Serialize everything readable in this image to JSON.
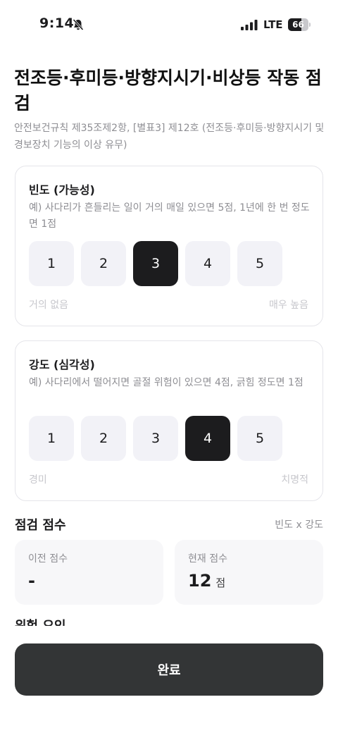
{
  "status_bar": {
    "time": "9:14",
    "network": "LTE",
    "battery": "66",
    "battery_level": 0.66
  },
  "page": {
    "title": "전조등·후미등·방향지시기·비상등 작동 점검",
    "subtitle": "안전보건규칙 제35조제2항, [별표3] 제12호 (전조등·후미등·방향지시기 및 경보장치 기능의 이상 유무)"
  },
  "frequency": {
    "title": "빈도 (가능성)",
    "description": "예) 사다리가 흔들리는 일이 거의 매일 있으면 5점, 1년에 한 번 정도면 1점",
    "options": [
      "1",
      "2",
      "3",
      "4",
      "5"
    ],
    "selected": 3,
    "min_label": "거의 없음",
    "max_label": "매우 높음"
  },
  "severity": {
    "title": "강도 (심각성)",
    "description": "예) 사다리에서 떨어지면 골절 위험이 있으면 4점, 긁힘 정도면 1점",
    "options": [
      "1",
      "2",
      "3",
      "4",
      "5"
    ],
    "selected": 4,
    "min_label": "경미",
    "max_label": "치명적"
  },
  "score": {
    "title": "점검 점수",
    "formula": "빈도 x 강도",
    "previous_label": "이전 점수",
    "previous_value": "-",
    "current_label": "현재 점수",
    "current_value": "12",
    "unit": "점"
  },
  "next_section_title": "위험 요인",
  "done_button": "완료",
  "icons": {
    "bell": "bell-slash-icon",
    "signal": "cellular-signal-icon",
    "battery": "battery-icon"
  }
}
